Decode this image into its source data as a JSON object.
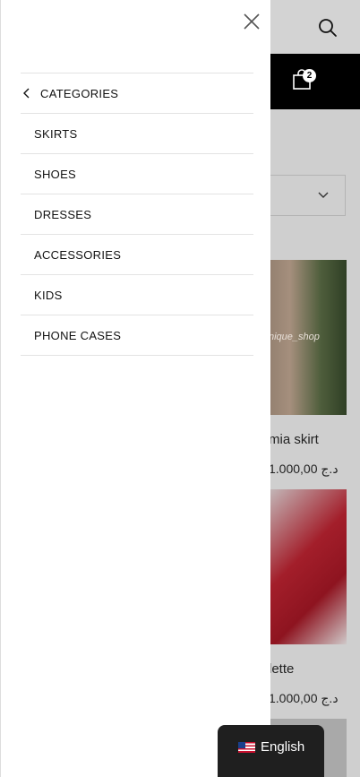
{
  "drawer": {
    "back_label": "CATEGORIES",
    "items": [
      {
        "label": "SKIRTS"
      },
      {
        "label": "SHOES"
      },
      {
        "label": "DRESSES"
      },
      {
        "label": "ACCESSORIES"
      },
      {
        "label": "KIDS"
      },
      {
        "label": "PHONE CASES"
      }
    ]
  },
  "header": {
    "cart_count": "2"
  },
  "products": [
    {
      "image_caption": "nique_shop",
      "name": "mia skirt",
      "price": "1.000,00 د.ج"
    },
    {
      "name": "lette",
      "price": "1.000,00 د.ج"
    }
  ],
  "language": {
    "label": "English",
    "flag_icon": "us-flag-icon"
  },
  "colors": {
    "cart_bar": "#000000",
    "lang_bg": "#1f1f1f"
  }
}
